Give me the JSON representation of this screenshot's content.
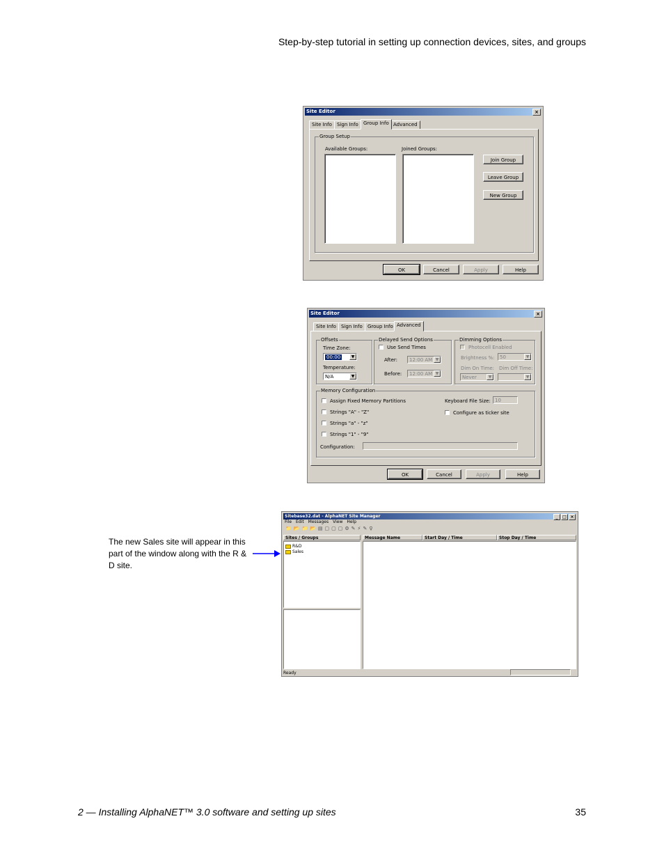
{
  "page": {
    "header": "Step-by-step tutorial in setting up connection devices, sites, and groups",
    "footer_left": "2 — Installing AlphaNET™ 3.0 software and setting up sites",
    "page_number": "35",
    "callout": "The new Sales site will appear in this part of the window along with the R & D site."
  },
  "dialog1": {
    "title": "Site Editor",
    "close": "×",
    "tabs": [
      "Site Info",
      "Sign Info",
      "Group Info",
      "Advanced"
    ],
    "active_tab": "Group Info",
    "group_label": "Group Setup",
    "available_label": "Available Groups:",
    "joined_label": "Joined Groups:",
    "side_buttons": [
      "Join Group",
      "Leave Group",
      "New Group"
    ],
    "buttons": [
      "OK",
      "Cancel",
      "Apply",
      "Help"
    ]
  },
  "dialog2": {
    "title": "Site Editor",
    "close": "×",
    "tabs": [
      "Site Info",
      "Sign Info",
      "Group Info",
      "Advanced"
    ],
    "active_tab": "Advanced",
    "offsets": {
      "label": "Offsets",
      "time_zone_label": "Time Zone:",
      "time_zone_value": "00:00",
      "temperature_label": "Temperature:",
      "temperature_value": "N/A"
    },
    "delayed": {
      "label": "Delayed Send Options",
      "use_send_times": "Use Send Times",
      "after_label": "After:",
      "after_value": "12:00 AM",
      "before_label": "Before:",
      "before_value": "12:00 AM"
    },
    "dimming": {
      "label": "Dimming Options",
      "photocell": "Photocell Enabled",
      "brightness_label": "Brightness %:",
      "brightness_value": "50",
      "dim_on_label": "Dim On Time:",
      "dim_off_label": "Dim Off Time:",
      "dim_on_value": "Never",
      "dim_off_value": ""
    },
    "memory": {
      "label": "Memory Configuration",
      "assign": "Assign Fixed Memory Partitions",
      "strings_upper": "Strings \"A\" - \"Z\"",
      "strings_lower": "Strings \"a\" - \"z\"",
      "strings_digits": "Strings \"1\" - \"9\"",
      "configuration_label": "Configuration:",
      "keyboard_label": "Keyboard File Size:",
      "keyboard_value": "10",
      "ticker": "Configure as ticker site"
    },
    "buttons": [
      "OK",
      "Cancel",
      "Apply",
      "Help"
    ]
  },
  "manager": {
    "title": "Sitebase32.dat - AlphaNET Site Manager",
    "window_buttons": [
      "_",
      "□",
      "×"
    ],
    "menu": [
      "File",
      "Edit",
      "Messages",
      "View",
      "Help"
    ],
    "toolbar_icons": [
      "📁",
      "📂",
      "📁",
      "📂",
      "▤",
      "▢",
      "▢",
      "▢",
      "⚙",
      "✎",
      "⚡",
      "✎",
      "♀"
    ],
    "sites_header": "Sites / Groups",
    "sites": [
      "R&D",
      "Sales"
    ],
    "columns": [
      "Message Name",
      "Start Day / Time",
      "Stop Day / Time"
    ],
    "status": "Ready"
  },
  "colors": {
    "titlebar": "#0a246a",
    "dialog_bg": "#d4d0c8",
    "arrow": "#0000ff"
  }
}
